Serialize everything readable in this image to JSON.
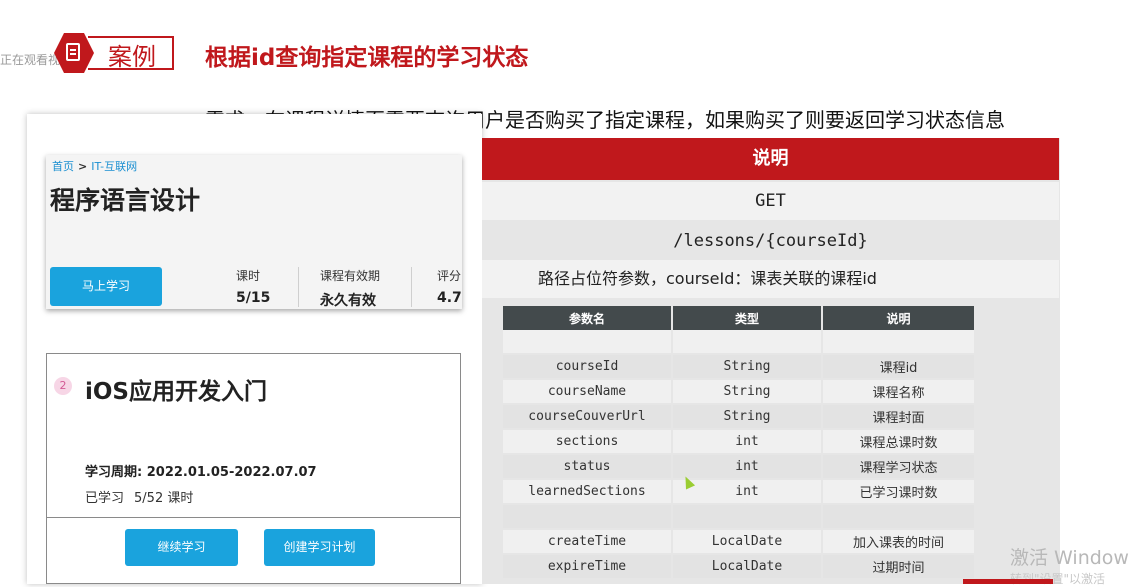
{
  "header": {
    "badge_label": "案例",
    "title": "根据id查询指定课程的学习状态",
    "watching_text": "正在观看视",
    "requirement": "需求：在课程详情页需要查询用户是否购买了指定课程，如果购买了则要返回学习状态信息"
  },
  "course_card": {
    "breadcrumb_home": "首页",
    "breadcrumb_sep": ">",
    "breadcrumb_category": "IT-互联网",
    "title": "程序语言设计",
    "learn_button": "马上学习",
    "stats": [
      {
        "label": "课时",
        "value": "5/15"
      },
      {
        "label": "课程有效期",
        "value": "永久有效"
      },
      {
        "label": "评分",
        "value": "4.7"
      }
    ]
  },
  "my_course": {
    "index": "2",
    "title": "iOS应用开发入门",
    "period_label": "学习周期: 2022.01.05-2022.07.07",
    "progress_label": "已学习",
    "progress_value": "5/52 课时",
    "continue_button": "继续学习",
    "plan_button": "创建学习计划"
  },
  "api": {
    "header": "说明",
    "method": "GET",
    "path": "/lessons/{courseId}",
    "path_param": "路径占位符参数，courseId：课表关联的课程id",
    "columns": [
      "参数名",
      "类型",
      "说明"
    ],
    "rows": [
      [
        "",
        "",
        ""
      ],
      [
        "courseId",
        "String",
        "课程id"
      ],
      [
        "courseName",
        "String",
        "课程名称"
      ],
      [
        "courseCouverUrl",
        "String",
        "课程封面"
      ],
      [
        "sections",
        "int",
        "课程总课时数"
      ],
      [
        "status",
        "int",
        "课程学习状态"
      ],
      [
        "learnedSections",
        "int",
        "已学习课时数"
      ],
      [
        "",
        "",
        ""
      ],
      [
        "createTime",
        "LocalDate",
        "加入课表的时间"
      ],
      [
        "expireTime",
        "LocalDate",
        "过期时间"
      ]
    ]
  },
  "watermark": {
    "line1": "激活 Window",
    "line2": "转到\"设置\"以激活"
  },
  "colors": {
    "accent_red": "#c0181c",
    "button_blue": "#1aa3dd",
    "table_header": "#434a4c"
  }
}
